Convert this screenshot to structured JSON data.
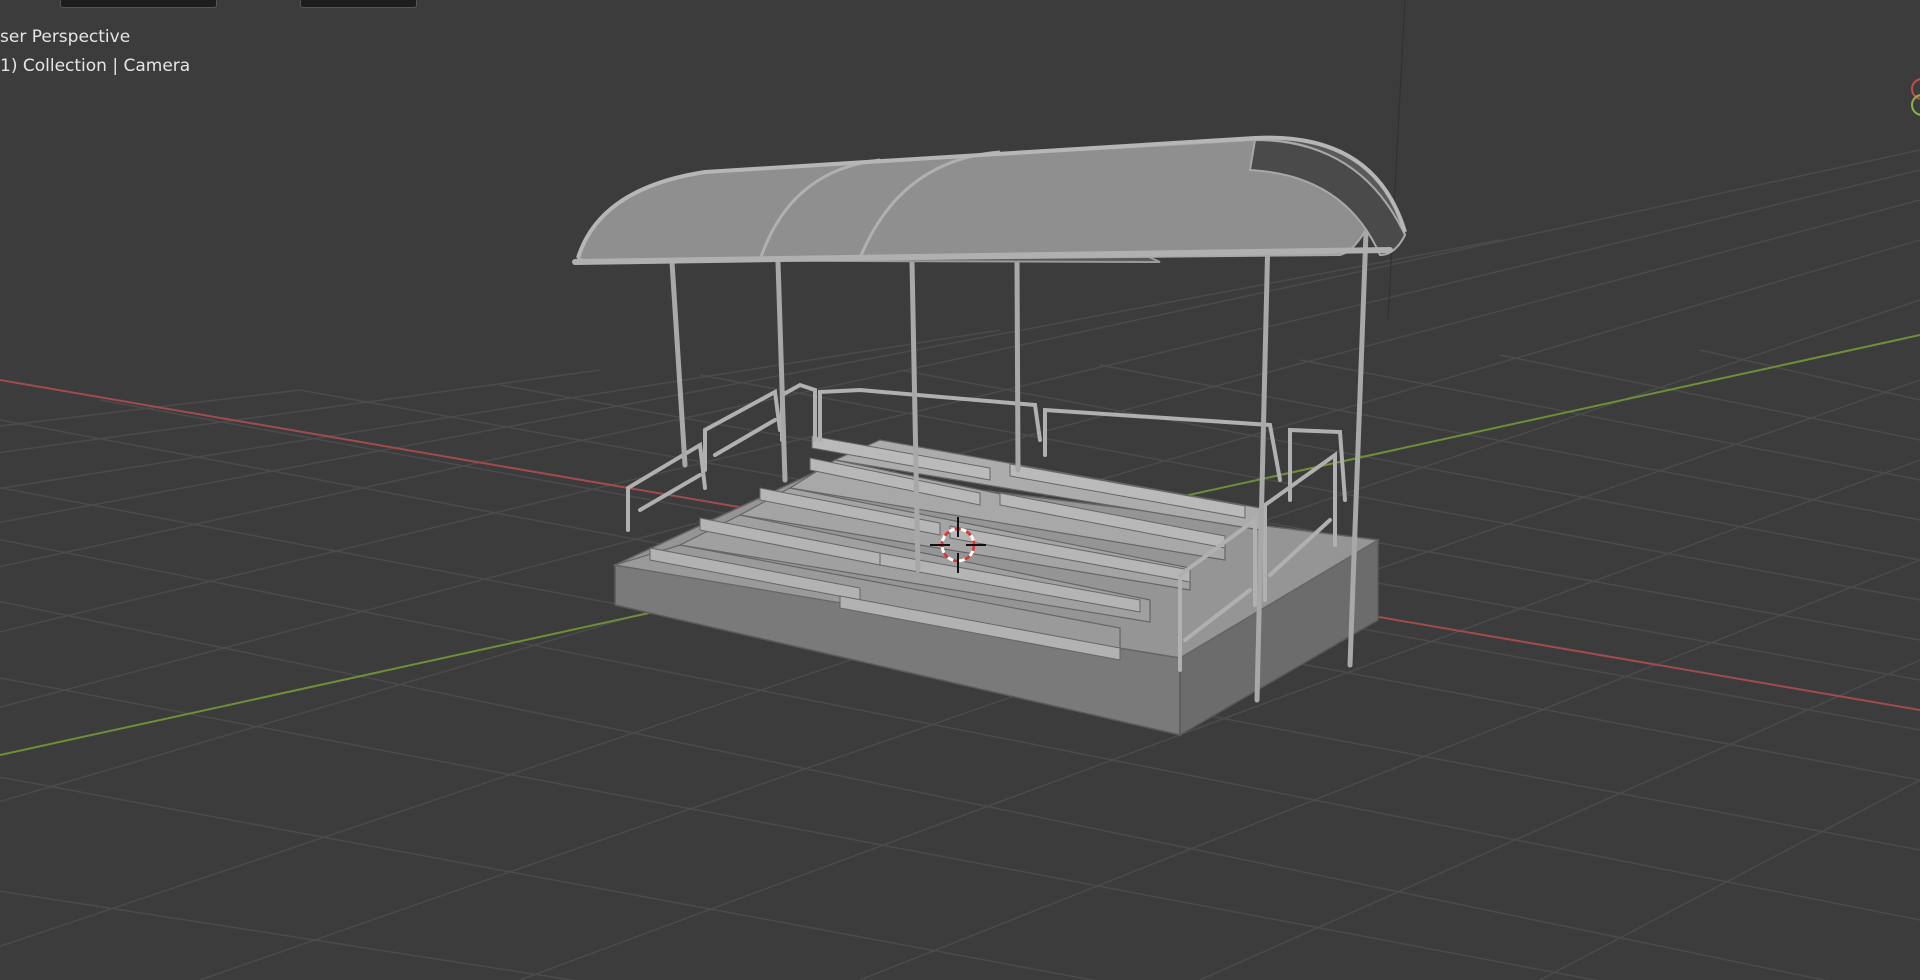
{
  "viewport": {
    "view_label": "ser Perspective",
    "collection_label": "1) Collection | Camera"
  },
  "colors": {
    "background": "#3c3c3c",
    "grid_line": "#4a4a4a",
    "x_axis": "#a04c4c",
    "y_axis": "#6e8f3a",
    "model": "#8e8e8e",
    "cursor": "#d43a3a"
  },
  "icons": [
    "3d-cursor-icon",
    "navigation-gizmo-icon"
  ]
}
